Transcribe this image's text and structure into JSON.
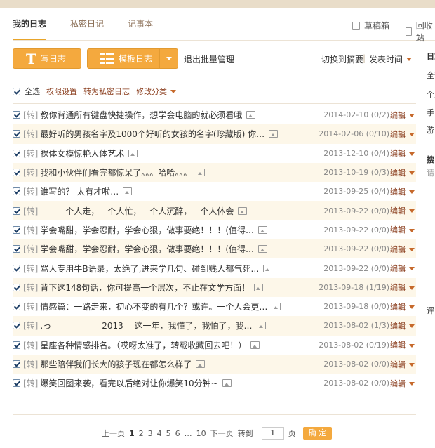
{
  "tabs": [
    {
      "label": "我的日志",
      "active": true
    },
    {
      "label": "私密日记",
      "active": false
    },
    {
      "label": "记事本",
      "active": false
    }
  ],
  "tab_right": {
    "drafts": "草稿箱",
    "recycle": "回收站"
  },
  "toolbar": {
    "write_label": "写日志",
    "write_icon_glyph": "T",
    "template_label": "模板日志",
    "exit_batch": "退出批量管理",
    "switch_summary": "切换到摘要",
    "separator": "|",
    "post_time": "发表时间"
  },
  "batch": {
    "select_all": "全选",
    "permission": "权限设置",
    "to_private": "转为私密日志",
    "modify_category": "修改分类"
  },
  "entries": [
    {
      "tag": "[转]",
      "title": "教你背通所有键盘快捷操作，想学会电脑的就必须看哦",
      "date": "2014-02-10",
      "count": "(0/2)",
      "edit": "编辑"
    },
    {
      "tag": "[转]",
      "title": "最好听的男孩名字及1000个好听的女孩的名字(珍藏版) 你…",
      "date": "2014-02-06",
      "count": "(0/10)",
      "edit": "编辑"
    },
    {
      "tag": "[转]",
      "title": "裸体女模惊艳人体艺术",
      "date": "2013-12-10",
      "count": "(0/4)",
      "edit": "编辑"
    },
    {
      "tag": "[转]",
      "title": "我和小伙伴们看完都惊呆了。。。哈哈。。。",
      "date": "2013-10-19",
      "count": "(0/3)",
      "edit": "编辑"
    },
    {
      "tag": "[转]",
      "title": "谁写的？ 太有才啦…",
      "date": "2013-09-25",
      "count": "(0/4)",
      "edit": "编辑"
    },
    {
      "tag": "[转]",
      "title": "　　一个人走，一个人忙，一个人沉醉，一个人体会",
      "date": "2013-09-22",
      "count": "(0/0)",
      "edit": "编辑"
    },
    {
      "tag": "[转]",
      "title": "学会嘴甜，学会忍耐，学会心狠，做事要绝！！！(值得…",
      "date": "2013-09-22",
      "count": "(0/0)",
      "edit": "编辑"
    },
    {
      "tag": "[转]",
      "title": "学会嘴甜，学会忍耐，学会心狠，做事要绝！！！(值得…",
      "date": "2013-09-22",
      "count": "(0/0)",
      "edit": "编辑"
    },
    {
      "tag": "[转]",
      "title": "骂人专用牛B语录，太绝了,进来学几句、碰到贱人都气死…",
      "date": "2013-09-22",
      "count": "(0/0)",
      "edit": "编辑"
    },
    {
      "tag": "[转]",
      "title": "背下这148句话，你可提高一个层次，不止在文学方面！",
      "date": "2013-09-18",
      "count": "(1/19)",
      "edit": "编辑"
    },
    {
      "tag": "[转]",
      "title": "情感篇：一路走来，初心不变的有几个？或许。一个人会更…",
      "date": "2013-09-18",
      "count": "(0/0)",
      "edit": "编辑"
    },
    {
      "tag": "[转]",
      "title": ".っ　　　　　　2013　 这一年，我懂了，我怕了，我…",
      "date": "2013-08-02",
      "count": "(1/3)",
      "edit": "编辑"
    },
    {
      "tag": "[转]",
      "title": "星座各种情感排名。（哎呀太准了，转载收藏回去吧！）",
      "date": "2013-08-02",
      "count": "(0/19)",
      "edit": "编辑"
    },
    {
      "tag": "[转]",
      "title": "那些陪伴我们长大的孩子现在都怎么样了",
      "date": "2013-08-02",
      "count": "(0/0)",
      "edit": "编辑"
    },
    {
      "tag": "[转]",
      "title": "爆笑回图来袭，看完以后绝对让你爆笑10分钟~",
      "date": "2013-08-02",
      "count": "(0/0)",
      "edit": "编辑"
    }
  ],
  "pager": {
    "prev": "上一页",
    "pages": [
      "1",
      "2",
      "3",
      "4",
      "5",
      "6"
    ],
    "ellipsis": "…",
    "last": "10",
    "next": "下一页",
    "goto": "转到",
    "input_value": "1",
    "unit": "页",
    "confirm": "确 定"
  },
  "sidebar": {
    "title_fragment": "日志",
    "items": [
      "全部",
      "个人",
      "手",
      "游",
      "搜",
      "请",
      "评"
    ]
  },
  "colors": {
    "accent": "#f4a93e",
    "link": "#8a3d1d",
    "tab_active_border": "#e8a52b"
  }
}
